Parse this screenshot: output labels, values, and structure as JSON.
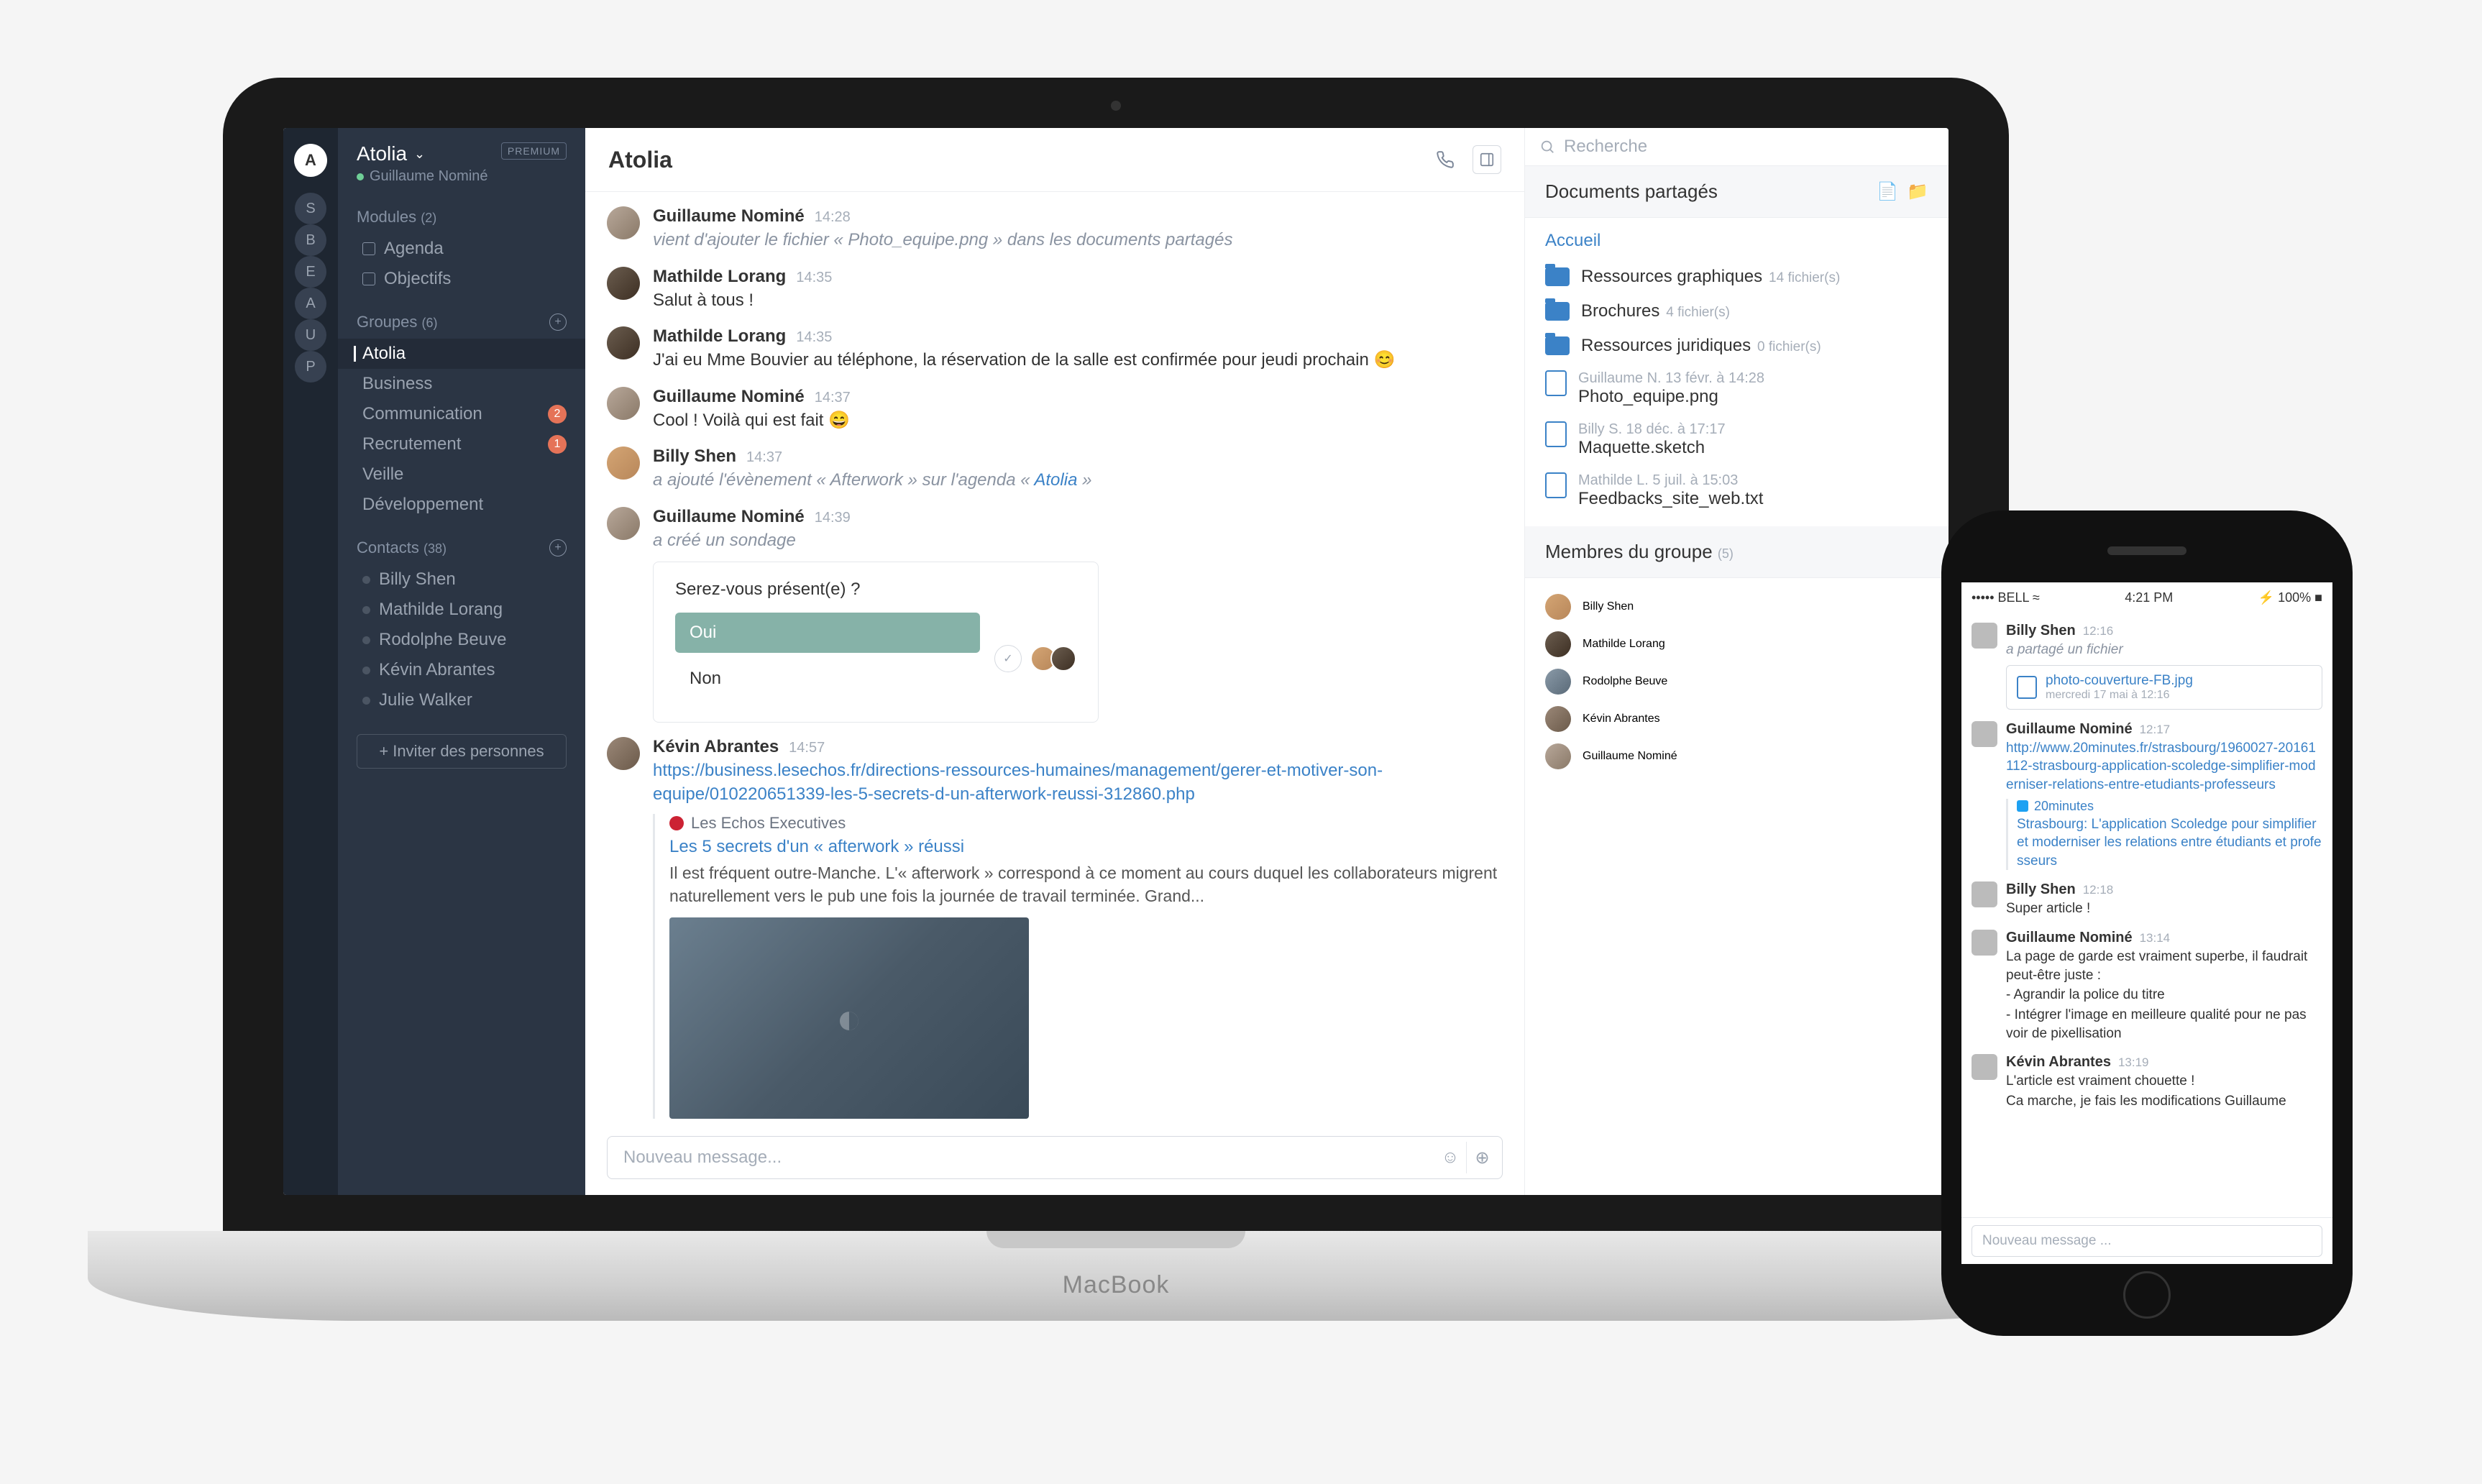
{
  "rail": {
    "main": "A",
    "items": [
      "S",
      "B",
      "E",
      "A",
      "U",
      "P"
    ]
  },
  "workspace": {
    "name": "Atolia",
    "user": "Guillaume Nominé",
    "premium": "PREMIUM"
  },
  "modules": {
    "label": "Modules",
    "count": "(2)",
    "items": [
      "Agenda",
      "Objectifs"
    ]
  },
  "groups": {
    "label": "Groupes",
    "count": "(6)",
    "items": [
      {
        "name": "Atolia",
        "active": true
      },
      {
        "name": "Business"
      },
      {
        "name": "Communication",
        "badge": "2"
      },
      {
        "name": "Recrutement",
        "badge": "1"
      },
      {
        "name": "Veille"
      },
      {
        "name": "Développement"
      }
    ]
  },
  "contacts": {
    "label": "Contacts",
    "count": "(38)",
    "items": [
      "Billy Shen",
      "Mathilde Lorang",
      "Rodolphe Beuve",
      "Kévin Abrantes",
      "Julie Walker"
    ]
  },
  "invite": "+ Inviter des personnes",
  "chat": {
    "title": "Atolia",
    "composer_placeholder": "Nouveau message...",
    "messages": [
      {
        "author": "Guillaume Nominé",
        "time": "14:28",
        "av": "av1",
        "italic": "vient d'ajouter le fichier « Photo_equipe.png » dans les documents partagés"
      },
      {
        "author": "Mathilde Lorang",
        "time": "14:35",
        "av": "av2",
        "text": "Salut à tous !"
      },
      {
        "author": "Mathilde Lorang",
        "time": "14:35",
        "av": "av2",
        "text": "J'ai eu Mme Bouvier au téléphone, la réservation de la salle est confirmée pour jeudi prochain 😊"
      },
      {
        "author": "Guillaume Nominé",
        "time": "14:37",
        "av": "av1",
        "text": "Cool ! Voilà qui est fait 😄"
      },
      {
        "author": "Billy Shen",
        "time": "14:37",
        "av": "av3",
        "italic_link": {
          "pre": "a ajouté l'évènement « Afterwork » sur l'agenda « ",
          "link": "Atolia",
          "post": " »"
        }
      },
      {
        "author": "Guillaume Nominé",
        "time": "14:39",
        "av": "av1",
        "italic": "a créé un sondage",
        "poll": {
          "question": "Serez-vous présent(e) ?",
          "opt1": "Oui",
          "opt2": "Non"
        }
      },
      {
        "author": "Kévin Abrantes",
        "time": "14:57",
        "av": "av4",
        "link_url": "https://business.lesechos.fr/directions-ressources-humaines/management/gerer-et-motiver-son-equipe/010220651339-les-5-secrets-d-un-afterwork-reussi-312860.php",
        "card": {
          "source": "Les Echos Executives",
          "title": "Les 5 secrets d'un « afterwork » réussi",
          "desc": "Il est fréquent outre-Manche. L'« afterwork » correspond à ce moment au cours duquel les collaborateurs migrent naturellement vers le pub une fois la journée de travail terminée. Grand..."
        }
      }
    ]
  },
  "search": {
    "placeholder": "Recherche"
  },
  "docs": {
    "title": "Documents partagés",
    "home": "Accueil",
    "folders": [
      {
        "name": "Ressources graphiques",
        "meta": "14 fichier(s)"
      },
      {
        "name": "Brochures",
        "meta": "4 fichier(s)"
      },
      {
        "name": "Ressources juridiques",
        "meta": "0 fichier(s)"
      }
    ],
    "files": [
      {
        "meta": "Guillaume N.   13 févr. à 14:28",
        "name": "Photo_equipe.png"
      },
      {
        "meta": "Billy S.   18 déc. à 17:17",
        "name": "Maquette.sketch"
      },
      {
        "meta": "Mathilde L.   5 juil. à 15:03",
        "name": "Feedbacks_site_web.txt"
      }
    ]
  },
  "members": {
    "title": "Membres du groupe",
    "count": "(5)",
    "items": [
      "Billy Shen",
      "Mathilde Lorang",
      "Rodolphe Beuve",
      "Kévin Abrantes",
      "Guillaume Nominé"
    ]
  },
  "phone": {
    "carrier": "••••• BELL",
    "signal": "≈",
    "time": "4:21 PM",
    "bt": "⚡",
    "batt": "100%",
    "composer": "Nouveau message ...",
    "msgs": [
      {
        "author": "Billy Shen",
        "time": "12:16",
        "italic": "a partagé un fichier",
        "attach": {
          "name": "photo-couverture-FB.jpg",
          "date": "mercredi 17 mai à 12:16"
        }
      },
      {
        "author": "Guillaume Nominé",
        "time": "12:17",
        "link": "http://www.20minutes.fr/strasbourg/1960027-20161112-strasbourg-application-scoledge-simplifier-moderniser-relations-entre-etudiants-professeurs",
        "card": {
          "source": "20minutes",
          "title": "Strasbourg: L'application Scoledge pour simplifier et moderniser les relations entre étudiants et professeurs"
        }
      },
      {
        "author": "Billy Shen",
        "time": "12:18",
        "text": "Super article !"
      },
      {
        "author": "Guillaume Nominé",
        "time": "13:14",
        "lines": [
          "La page de garde est vraiment superbe, il faudrait peut-être juste :",
          "- Agrandir la police du titre",
          "- Intégrer l'image en meilleure qualité pour ne pas voir de pixellisation"
        ]
      },
      {
        "author": "Kévin Abrantes",
        "time": "13:19",
        "lines": [
          "L'article est vraiment chouette !",
          "Ca marche, je fais les modifications Guillaume"
        ]
      }
    ]
  },
  "laptop_brand": "MacBook"
}
